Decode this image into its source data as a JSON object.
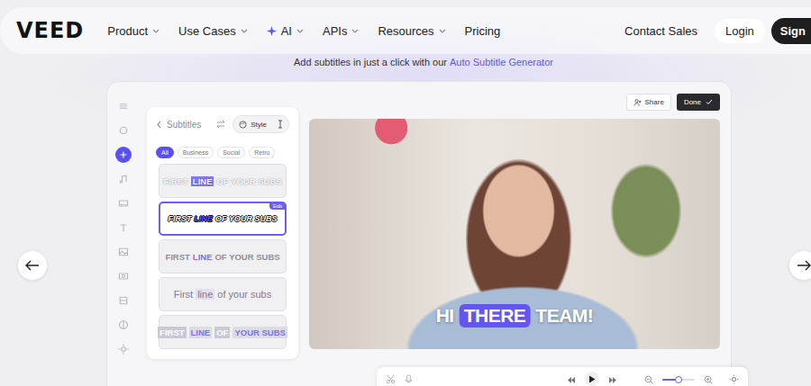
{
  "logo": "VEED",
  "nav": {
    "items": [
      {
        "label": "Product",
        "kind": "plain"
      },
      {
        "label": "Use Cases",
        "kind": "plain"
      },
      {
        "label": "AI",
        "kind": "sparkle"
      },
      {
        "label": "APIs",
        "kind": "plain"
      },
      {
        "label": "Resources",
        "kind": "plain"
      },
      {
        "label": "Pricing",
        "kind": "link"
      }
    ],
    "contact": "Contact Sales",
    "login": "Login",
    "signup": "Sign"
  },
  "promo": {
    "text": "Add subtitles in just a click with our",
    "link": "Auto Subtitle Generator"
  },
  "editor": {
    "rail": [
      {
        "selected": false
      },
      {
        "selected": false
      },
      {
        "selected": true
      },
      {
        "selected": false
      },
      {
        "selected": false
      },
      {
        "selected": false
      },
      {
        "selected": false
      },
      {
        "selected": false
      },
      {
        "selected": false
      },
      {
        "selected": false
      },
      {
        "selected": false
      }
    ],
    "panel": {
      "title": "Subtitles",
      "style_button": "Style",
      "filters": [
        {
          "label": "All",
          "selected": true
        },
        {
          "label": "Business",
          "selected": false
        },
        {
          "label": "Social",
          "selected": false
        },
        {
          "label": "Retro",
          "selected": false
        }
      ],
      "edit_badge": "Edit",
      "styles": [
        {
          "kind": "shadow",
          "selected": false,
          "parts": [
            {
              "text": "FIRST",
              "highlight": false
            },
            {
              "text": "LINE",
              "highlight": true
            },
            {
              "text": "OF YOUR SUBS",
              "highlight": false
            }
          ]
        },
        {
          "kind": "outline",
          "selected": true,
          "parts": [
            {
              "text": "FIRST",
              "highlight": false
            },
            {
              "text": "LINE",
              "highlight": true
            },
            {
              "text": "OF YOUR SUBS",
              "highlight": false
            }
          ]
        },
        {
          "kind": "plain",
          "selected": false,
          "parts": [
            {
              "text": "FIRST",
              "highlight": false
            },
            {
              "text": "LINE",
              "highlight": true
            },
            {
              "text": "OF YOUR SUBS",
              "highlight": false
            }
          ]
        },
        {
          "kind": "soft",
          "selected": false,
          "parts": [
            {
              "text": "First",
              "highlight": false
            },
            {
              "text": "line",
              "highlight": true
            },
            {
              "text": "of your subs",
              "highlight": false
            }
          ]
        },
        {
          "kind": "block",
          "selected": false,
          "parts": [
            {
              "text": "FIRST",
              "highlight": false
            },
            {
              "text": "LINE",
              "highlight": true
            },
            {
              "text": "OF",
              "highlight": false
            },
            {
              "text": "YOUR SUBS",
              "highlight": true
            }
          ]
        }
      ]
    },
    "toolbar": {
      "share": "Share",
      "done": "Done"
    },
    "caption": [
      {
        "text": "HI",
        "highlight": false
      },
      {
        "text": "THERE",
        "highlight": true
      },
      {
        "text": "TEAM!",
        "highlight": false
      }
    ],
    "playback": {
      "zoom": {
        "level": 0.5
      }
    }
  }
}
